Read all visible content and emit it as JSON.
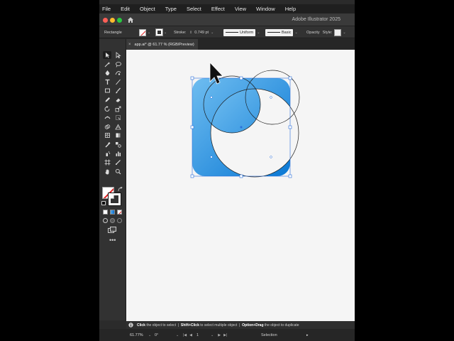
{
  "menubar": {
    "items": [
      "File",
      "Edit",
      "Object",
      "Type",
      "Select",
      "Effect",
      "View",
      "Window",
      "Help"
    ]
  },
  "titlebar": {
    "app_title": "Adobe Illustrator 2025"
  },
  "controlbar": {
    "tool_name": "Rectangle",
    "stroke_label": "Stroke:",
    "stroke_weight": "0.749 pt",
    "profile": "Uniform",
    "brush": "Basic",
    "opacity_label": "Opacity",
    "style_label": "Style:"
  },
  "document": {
    "tab_title": "app.ai* @ 61.77 % (RGB/Preview)",
    "close_glyph": "×"
  },
  "canvas": {
    "icon_gradient_start": "#6fbdf0",
    "icon_gradient_end": "#0a78d4",
    "selection_color": "#2a6fdb"
  },
  "hint": {
    "part1_bold": "Click",
    "part1": " the object to select  |  ",
    "part2_bold": "Shift+Click",
    "part2": " to select multiple object  |  ",
    "part3_bold": "Option+Drag",
    "part3": " the object to duplicate"
  },
  "statusbar": {
    "zoom": "61.77%",
    "rotation": "0°",
    "artboard_number": "1",
    "tool_status": "Selection"
  },
  "tools": {
    "icons": [
      "selection-tool-icon",
      "direct-selection-tool-icon",
      "magic-wand-tool-icon",
      "lasso-tool-icon",
      "pen-tool-icon",
      "curvature-tool-icon",
      "type-tool-icon",
      "line-segment-tool-icon",
      "rectangle-tool-icon",
      "paintbrush-tool-icon",
      "pencil-tool-icon",
      "eraser-tool-icon",
      "rotate-tool-icon",
      "scale-tool-icon",
      "width-tool-icon",
      "free-transform-tool-icon",
      "shape-builder-tool-icon",
      "perspective-grid-tool-icon",
      "mesh-tool-icon",
      "gradient-tool-icon",
      "eyedropper-tool-icon",
      "blend-tool-icon",
      "symbol-sprayer-tool-icon",
      "column-graph-tool-icon",
      "artboard-tool-icon",
      "slice-tool-icon",
      "hand-tool-icon",
      "zoom-tool-icon"
    ]
  }
}
